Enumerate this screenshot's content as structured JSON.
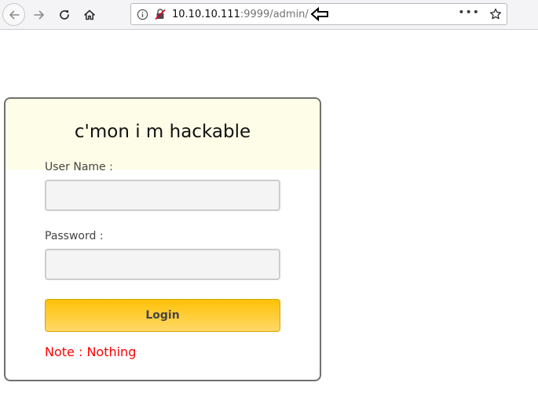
{
  "browser": {
    "url_host": "10.10.10.111",
    "url_rest": ":9999/admin/",
    "icons": {
      "back": "back-arrow-icon",
      "forward": "forward-arrow-icon",
      "reload": "reload-icon",
      "home": "home-icon",
      "info": "info-icon",
      "insecure": "insecure-lock-icon",
      "menu": "page-actions-icon",
      "bookmark": "bookmark-star-icon"
    },
    "page_actions_glyph": "•••"
  },
  "login": {
    "title": "c'mon i m hackable",
    "username_label": "User Name :",
    "username_value": "",
    "password_label": "Password :",
    "password_value": "",
    "button_label": "Login",
    "note": "Note : Nothing"
  },
  "colors": {
    "header_bg": "#fefee8",
    "button_top": "#ffc107",
    "button_bottom": "#ffd968",
    "note": "#ff0000",
    "card_border": "#6f6f6f"
  }
}
